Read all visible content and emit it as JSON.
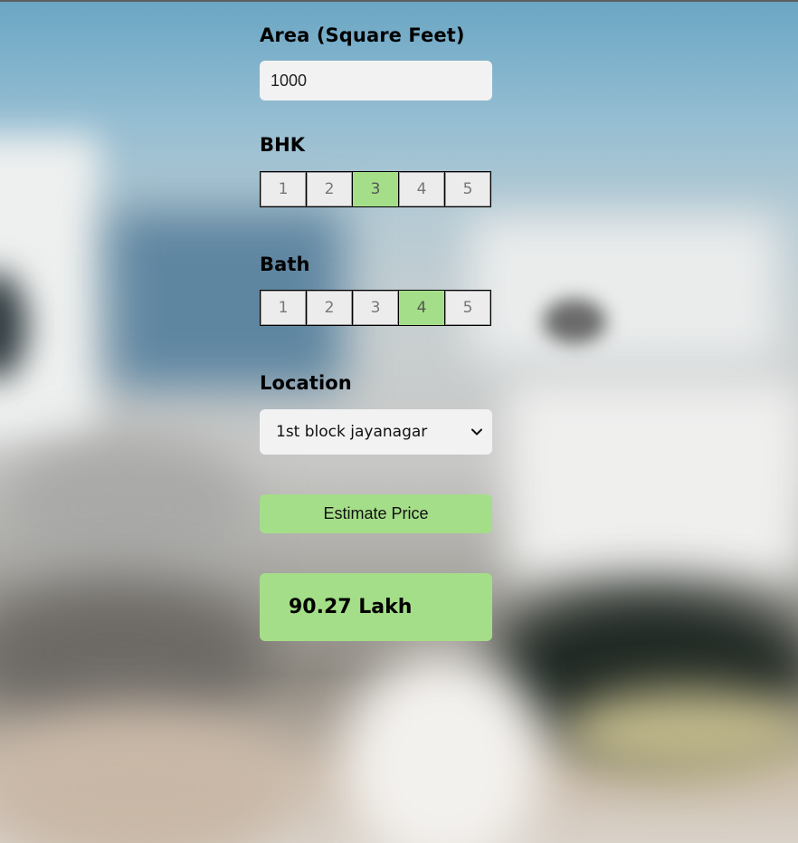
{
  "form": {
    "area": {
      "label": "Area (Square Feet)",
      "value": "1000"
    },
    "bhk": {
      "label": "BHK",
      "options": [
        "1",
        "2",
        "3",
        "4",
        "5"
      ],
      "selected": "3"
    },
    "bath": {
      "label": "Bath",
      "options": [
        "1",
        "2",
        "3",
        "4",
        "5"
      ],
      "selected": "4"
    },
    "location": {
      "label": "Location",
      "selected": "1st block jayanagar"
    },
    "estimate_label": "Estimate Price",
    "result": "90.27 Lakh"
  },
  "colors": {
    "accent": "#a4de88",
    "field_bg": "#f2f2f2"
  }
}
